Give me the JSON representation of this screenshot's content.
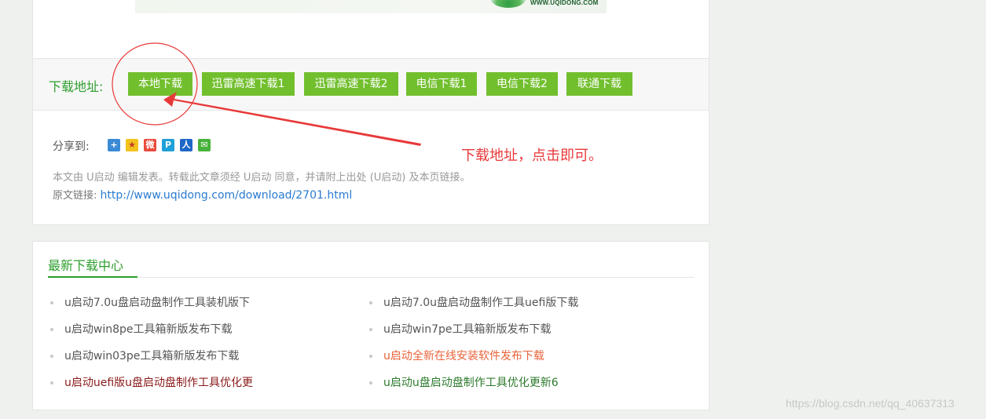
{
  "banner": {
    "logo_text": "WWW.UQIDONG.COM"
  },
  "download": {
    "label": "下载地址:",
    "buttons": [
      "本地下载",
      "迅雷高速下载1",
      "迅雷高速下载2",
      "电信下载1",
      "电信下载2",
      "联通下载"
    ]
  },
  "share": {
    "label": "分享到:",
    "icons": [
      "plus-share-icon",
      "qzone-star-icon",
      "weibo-icon",
      "tencent-weibo-icon",
      "renren-icon",
      "wechat-icon"
    ]
  },
  "copyright": "本文由 U启动 编辑发表。转载此文章须经 U启动 同意，并请附上出处 (U启动) 及本页链接。",
  "original_link": {
    "label": "原文链接:",
    "url": "http://www.uqidong.com/download/2701.html"
  },
  "latest": {
    "title": "最新下载中心",
    "items": [
      {
        "text": "u启动7.0u盘启动盘制作工具装机版下",
        "color": "#555555"
      },
      {
        "text": "u启动7.0u盘启动盘制作工具uefi版下载",
        "color": "#555555"
      },
      {
        "text": "u启动win8pe工具箱新版发布下载",
        "color": "#555555"
      },
      {
        "text": "u启动win7pe工具箱新版发布下载",
        "color": "#555555"
      },
      {
        "text": "u启动win03pe工具箱新版发布下载",
        "color": "#555555"
      },
      {
        "text": "u启动全新在线安装软件发布下载",
        "color": "#e8633a"
      },
      {
        "text": "u启动uefi版u盘启动盘制作工具优化更",
        "color": "#8b1a1a"
      },
      {
        "text": "u启动u盘启动盘制作工具优化更新6",
        "color": "#2d7a2d"
      }
    ]
  },
  "annotation": {
    "text": "下载地址，点击即可。"
  },
  "watermark": "https://blog.csdn.net/qq_40637313",
  "colors": {
    "accent_green": "#2e9e2e",
    "button_green": "#72bf2e",
    "annotation_red": "#e8393a",
    "link_blue": "#2a7bd0"
  }
}
